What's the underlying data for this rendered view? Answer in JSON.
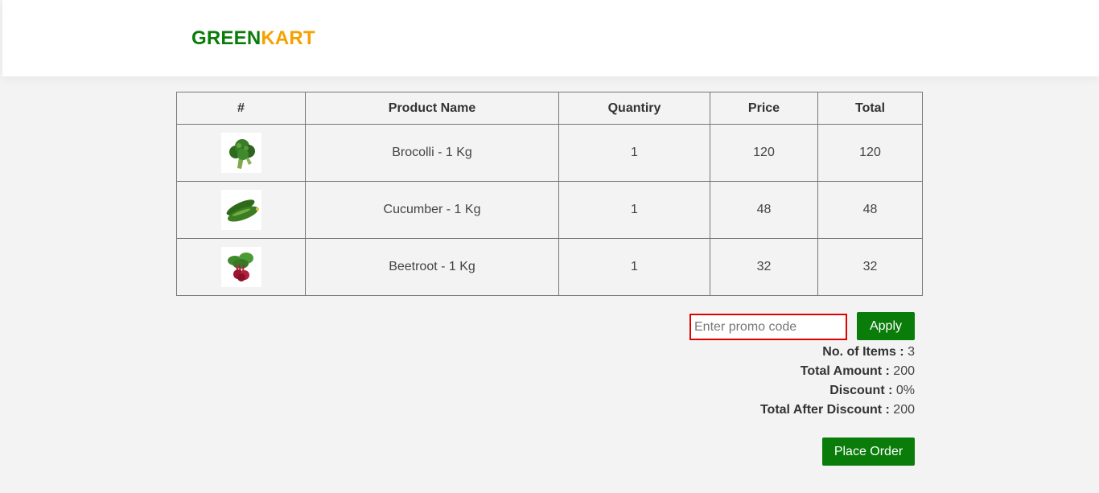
{
  "brand": {
    "part1": "GREEN",
    "part2": "KART"
  },
  "table": {
    "headers": [
      "#",
      "Product Name",
      "Quantiry",
      "Price",
      "Total"
    ],
    "rows": [
      {
        "image": "broccoli-icon",
        "name": "Brocolli - 1 Kg",
        "qty": "1",
        "price": "120",
        "total": "120"
      },
      {
        "image": "cucumber-icon",
        "name": "Cucumber - 1 Kg",
        "qty": "1",
        "price": "48",
        "total": "48"
      },
      {
        "image": "beetroot-icon",
        "name": "Beetroot - 1 Kg",
        "qty": "1",
        "price": "32",
        "total": "32"
      }
    ]
  },
  "promo": {
    "placeholder": "Enter promo code",
    "value": "",
    "apply_label": "Apply"
  },
  "summary": {
    "items_label": "No. of Items :",
    "items_value": "3",
    "amount_label": "Total Amount :",
    "amount_value": "200",
    "discount_label": "Discount :",
    "discount_value": "0%",
    "after_label": "Total After Discount :",
    "after_value": "200"
  },
  "place_order_label": "Place Order",
  "colors": {
    "brand_green": "#0a7c0a",
    "brand_orange": "#f5a100",
    "promo_border": "#e00000"
  }
}
